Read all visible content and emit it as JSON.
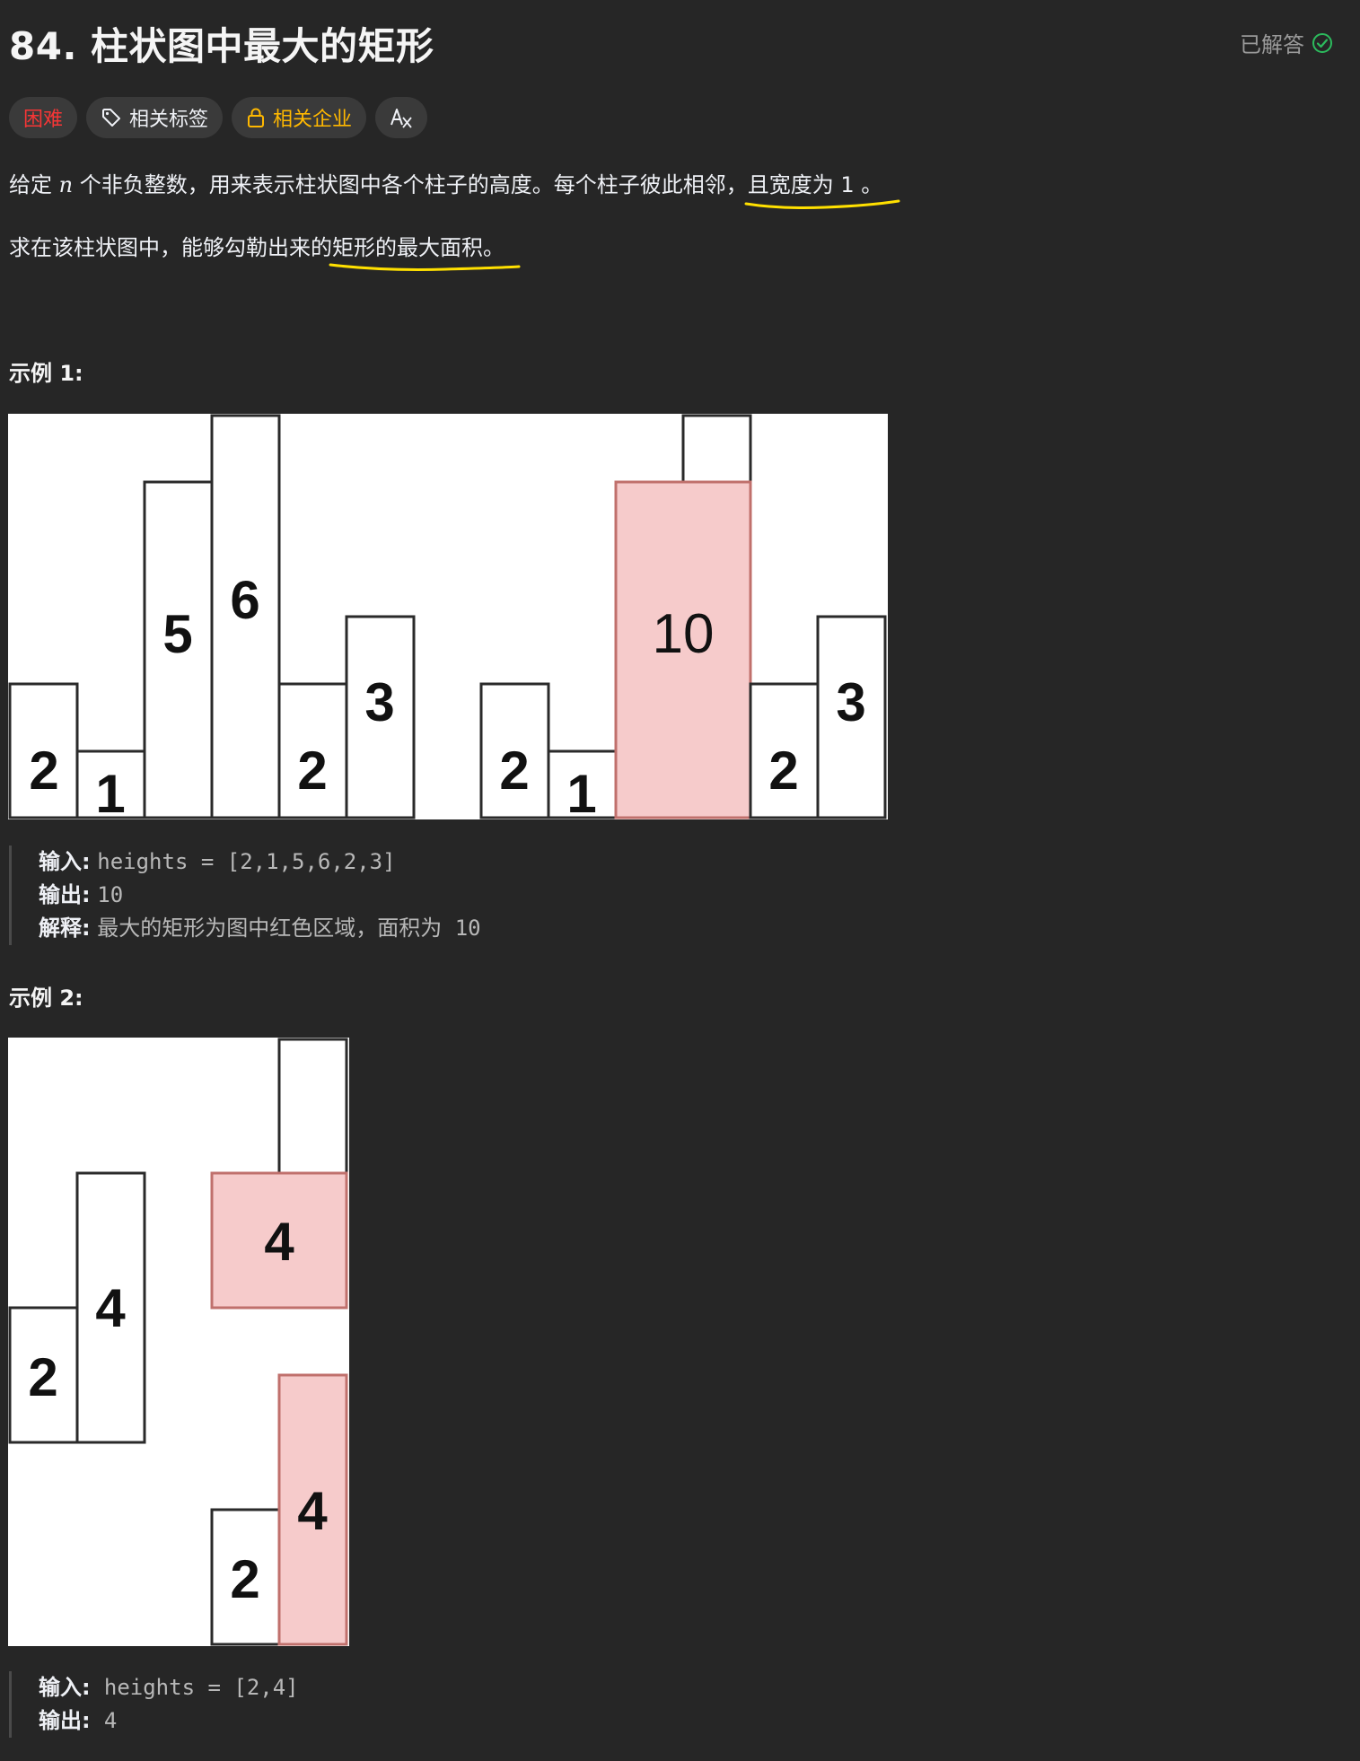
{
  "problem": {
    "title": "84. 柱状图中最大的矩形",
    "status": "已解答",
    "tags": [
      {
        "label": "困难",
        "icon": ""
      },
      {
        "label": "相关标签",
        "icon": "tag-icon"
      },
      {
        "label": "相关企业",
        "icon": "lock-icon"
      },
      {
        "label": "",
        "icon": "translate-icon"
      }
    ],
    "description": {
      "line1_pre": "给定 ",
      "line1_var": "n",
      "line1_mid": " 个非负整数，用来表示柱状图中各个柱子的高度。每个柱子彼此相邻，",
      "line1_ul": "且宽度为 1 。",
      "line2_pre": "求在该柱状图中，能够勾勒出来的",
      "line2_ul": "矩形的最大面积。"
    }
  },
  "examples": [
    {
      "heading": "示例 1:",
      "input_label": "输入:",
      "input_value": "heights = [2,1,5,6,2,3]",
      "output_label": "输出:",
      "output_value": "10",
      "explain_label": "解释:",
      "explain_value": "最大的矩形为图中红色区域，面积为 10"
    },
    {
      "heading": "示例 2:",
      "input_label": "输入:",
      "input_value": "heights = [2,4]",
      "output_label": "输出:",
      "output_value": "4"
    }
  ],
  "colors": {
    "background": "#262626",
    "hard": "#f63636",
    "company": "#ffb800",
    "solved_check": "#2cbb5d",
    "underline": "#ffe000",
    "highlight_fill": "#f6cbcb",
    "highlight_stroke": "#c0706c"
  }
}
